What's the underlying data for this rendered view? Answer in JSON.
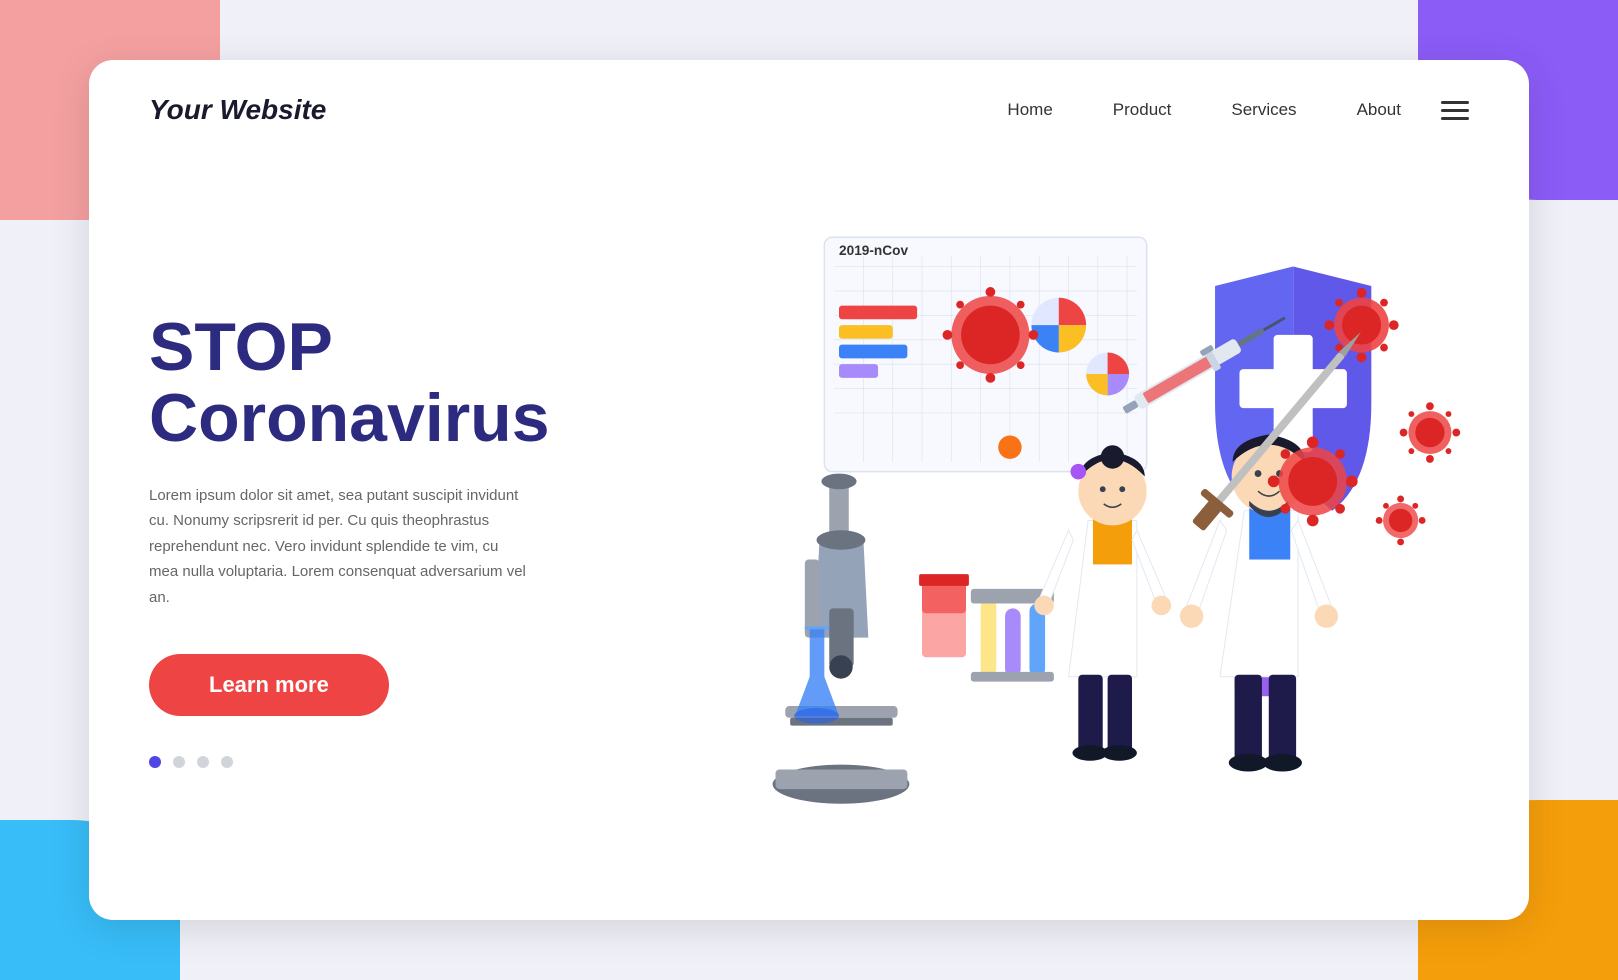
{
  "background": {
    "colors": {
      "topLeft": "#f4a0a0",
      "topRight": "#8b5cf6",
      "bottomLeft": "#38bdf8",
      "bottomRight": "#f59e0b"
    }
  },
  "navbar": {
    "logo": "Your Website",
    "links": [
      "Home",
      "Product",
      "Services",
      "About"
    ],
    "hamburger_label": "menu"
  },
  "hero": {
    "headline_line1": "STOP",
    "headline_line2": "Coronavirus",
    "description": "Lorem ipsum dolor sit amet, sea putant suscipit invidunt cu. Nonumy scripsrerit id per. Cu quis theophrastus reprehendunt nec. Vero invidunt splendide te vim, cu mea nulla voluptaria. Lorem consenquat adversarium vel an.",
    "cta_button": "Learn more",
    "dots": [
      {
        "active": true
      },
      {
        "active": false
      },
      {
        "active": false
      },
      {
        "active": false
      }
    ]
  },
  "chart": {
    "title": "2019-nCov"
  }
}
